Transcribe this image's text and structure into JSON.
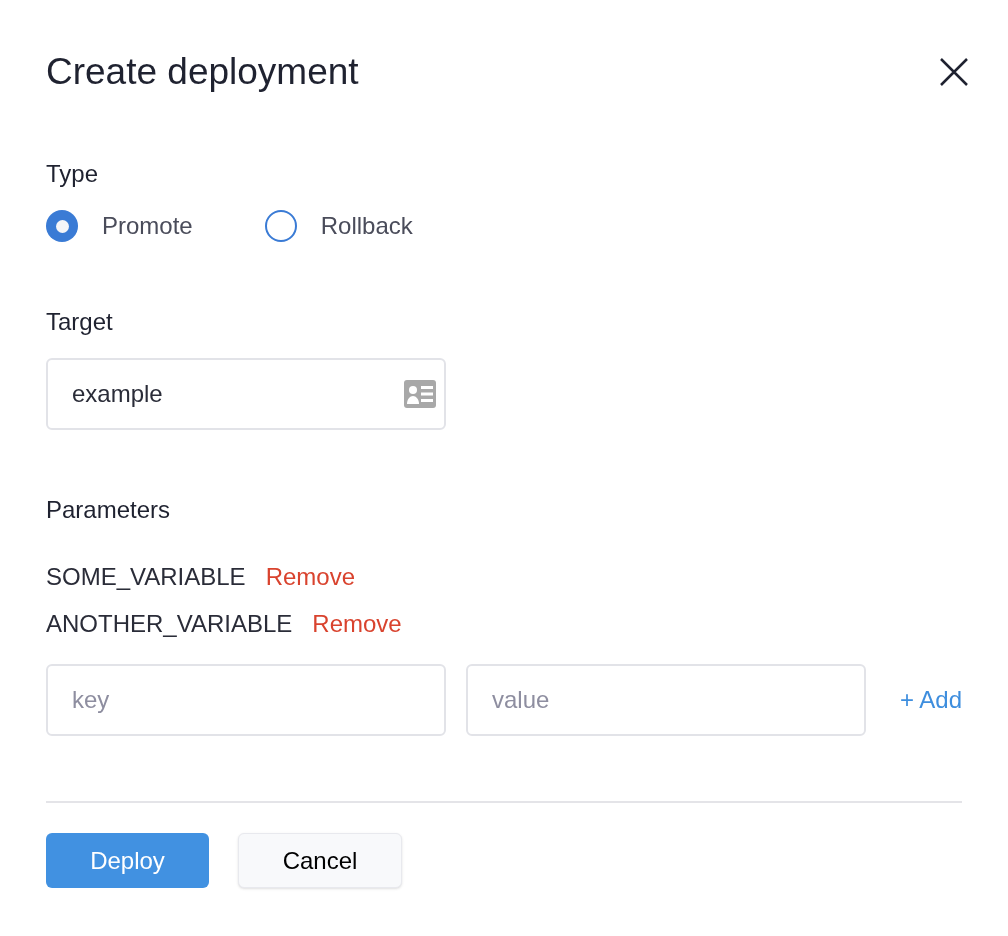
{
  "dialog": {
    "title": "Create deployment"
  },
  "type": {
    "label": "Type",
    "options": [
      {
        "label": "Promote",
        "selected": true
      },
      {
        "label": "Rollback",
        "selected": false
      }
    ]
  },
  "target": {
    "label": "Target",
    "value": "example"
  },
  "parameters": {
    "label": "Parameters",
    "items": [
      {
        "name": "SOME_VARIABLE",
        "action": "Remove"
      },
      {
        "name": "ANOTHER_VARIABLE",
        "action": "Remove"
      }
    ],
    "key_placeholder": "key",
    "value_placeholder": "value",
    "add": "+ Add"
  },
  "buttons": {
    "primary": "Deploy",
    "secondary": "Cancel"
  }
}
